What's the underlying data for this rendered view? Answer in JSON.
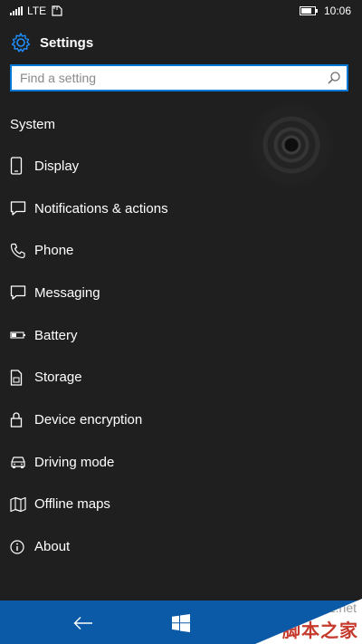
{
  "status_bar": {
    "network": "LTE",
    "time": "10:06",
    "battery_level": 0.8
  },
  "header": {
    "title": "Settings"
  },
  "search": {
    "placeholder": "Find a setting"
  },
  "section": {
    "label": "System"
  },
  "menu": {
    "items": [
      {
        "label": "Display",
        "icon": "display-icon"
      },
      {
        "label": "Notifications & actions",
        "icon": "notifications-icon"
      },
      {
        "label": "Phone",
        "icon": "phone-icon"
      },
      {
        "label": "Messaging",
        "icon": "messaging-icon"
      },
      {
        "label": "Battery",
        "icon": "battery-icon"
      },
      {
        "label": "Storage",
        "icon": "storage-icon"
      },
      {
        "label": "Device encryption",
        "icon": "lock-icon"
      },
      {
        "label": "Driving mode",
        "icon": "car-icon"
      },
      {
        "label": "Offline maps",
        "icon": "map-icon"
      },
      {
        "label": "About",
        "icon": "info-icon"
      }
    ]
  },
  "taskbar": {
    "color": "#0b5aa8"
  },
  "watermark": {
    "site": "jb51.net",
    "text": "脚本之家"
  },
  "colors": {
    "accent": "#0078d7",
    "background": "#1f1f1f"
  }
}
